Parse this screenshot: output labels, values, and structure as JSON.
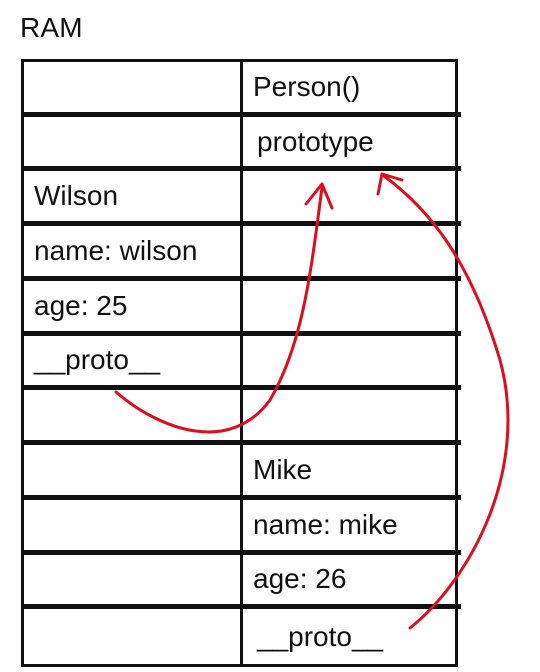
{
  "title": "RAM",
  "colors": {
    "grid": "#111111",
    "arrow": "#d90f1e"
  },
  "rows": [
    {
      "left": "",
      "right": "Person()"
    },
    {
      "left": "",
      "right": "prototype"
    },
    {
      "left": "Wilson",
      "right": ""
    },
    {
      "left": "name: wilson",
      "right": ""
    },
    {
      "left": "age: 25",
      "right": ""
    },
    {
      "left": "__proto__",
      "right": ""
    },
    {
      "left": "",
      "right": ""
    },
    {
      "left": "",
      "right": "Mike"
    },
    {
      "left": "",
      "right": "name: mike"
    },
    {
      "left": "",
      "right": "age: 26"
    },
    {
      "left": "",
      "right": "__proto__"
    }
  ]
}
